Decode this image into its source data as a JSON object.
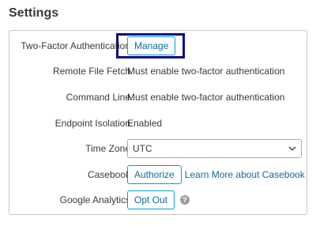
{
  "page": {
    "title": "Settings"
  },
  "settings": [
    {
      "label": "Two-Factor Authentication",
      "button": "Manage"
    },
    {
      "label": "Remote File Fetch",
      "text": "Must enable two-factor authentication"
    },
    {
      "label": "Command Line",
      "text": "Must enable two-factor authentication"
    },
    {
      "label": "Endpoint Isolation",
      "text": "Enabled"
    },
    {
      "label": "Time Zone",
      "select_value": "UTC"
    },
    {
      "label": "Casebook",
      "button": "Authorize",
      "link": "Learn More about Casebook"
    },
    {
      "label": "Google Analytics",
      "button": "Opt Out",
      "help_glyph": "?"
    }
  ],
  "colors": {
    "accent": "#049fd9",
    "link": "#0d6a9e",
    "highlight": "#0a0a8c"
  },
  "icons": {
    "dropdown": "chevron-down-icon",
    "help": "question-icon"
  }
}
